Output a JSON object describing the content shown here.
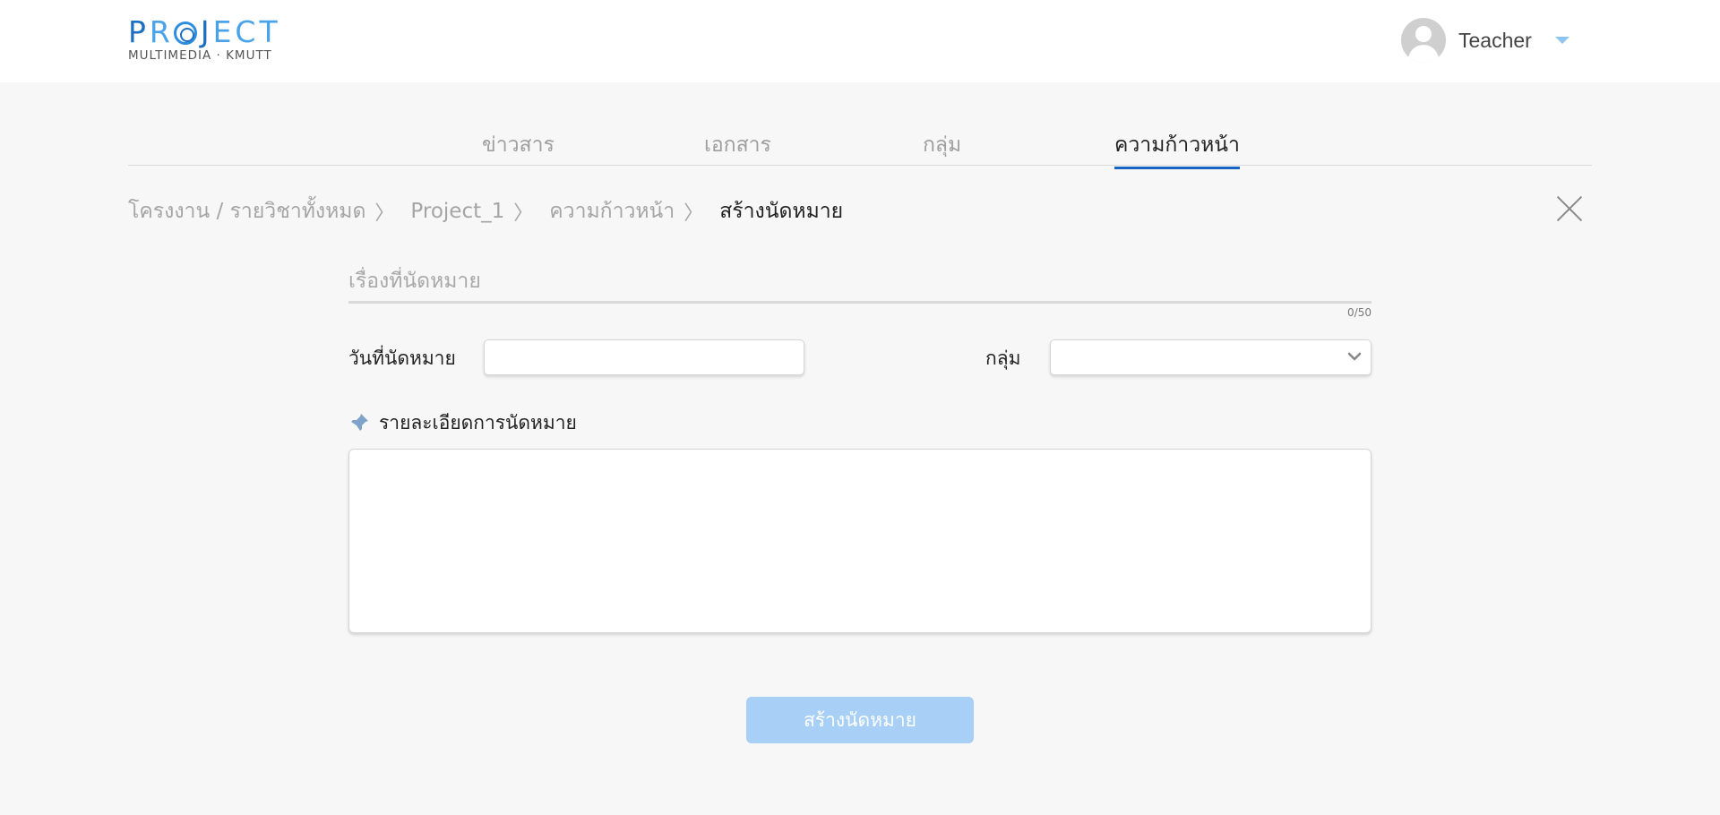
{
  "header": {
    "logo": {
      "main": "PROJECT",
      "sub": "MULTIMEDIA · KMUTT"
    },
    "user": {
      "name": "Teacher"
    }
  },
  "tabs": [
    {
      "label": "ข่าวสาร",
      "active": false
    },
    {
      "label": "เอกสาร",
      "active": false
    },
    {
      "label": "กลุ่ม",
      "active": false
    },
    {
      "label": "ความก้าวหน้า",
      "active": true
    }
  ],
  "breadcrumb": {
    "items": [
      "โครงงาน / รายวิชาทั้งหมด",
      "Project_1",
      "ความก้าวหน้า"
    ],
    "current": "สร้างนัดหมาย",
    "separator": "〉"
  },
  "form": {
    "title_placeholder": "เรื่องที่นัดหมาย",
    "title_value": "",
    "counter": "0/50",
    "date_label": "วันที่นัดหมาย",
    "date_value": "",
    "group_label": "กลุ่ม",
    "group_selected": "",
    "detail_label": "รายละเอียดการนัดหมาย",
    "detail_value": "",
    "submit_label": "สร้างนัดหมาย"
  },
  "colors": {
    "brand": "#1e6fc0",
    "active_tab_underline": "#1565c0",
    "submit_disabled": "#a8d0f7",
    "background": "#f7f7f7"
  },
  "icons": [
    "logo",
    "avatar-icon",
    "chevron-down-icon",
    "close-icon",
    "pin-icon",
    "select-chevron-icon"
  ]
}
